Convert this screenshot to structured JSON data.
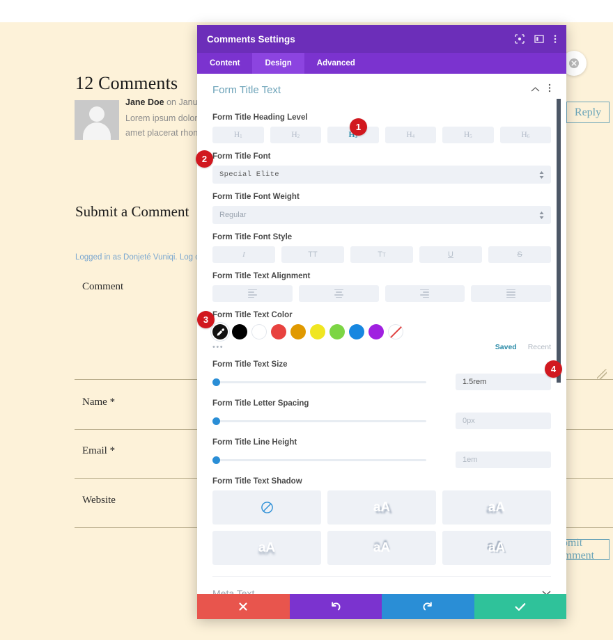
{
  "page": {
    "comments_heading": "12 Comments",
    "comment": {
      "author": "Jane Doe",
      "meta_suffix": " on January",
      "body_line1": "Lorem ipsum dolor sit",
      "body_line2": "amet placerat rhoncus"
    },
    "reply_button": "Reply",
    "submit_heading": "Submit a Comment",
    "logged_in_text": "Logged in as Donjeté Vuniqi. Log out?",
    "fields": [
      {
        "label": "Comment"
      },
      {
        "label": "Name *"
      },
      {
        "label": "Email *"
      },
      {
        "label": "Website"
      }
    ],
    "submit_button": "Submit Comment"
  },
  "modal": {
    "title": "Comments Settings",
    "header_icons": [
      "target-icon",
      "panel-layout-icon",
      "vertical-dots-icon"
    ],
    "tabs": [
      {
        "label": "Content",
        "active": false
      },
      {
        "label": "Design",
        "active": true
      },
      {
        "label": "Advanced",
        "active": false
      }
    ],
    "section": {
      "title": "Form Title Text",
      "collapse_icon": "chevron-up-icon",
      "menu_icon": "vertical-dots-icon"
    },
    "heading_level": {
      "label": "Form Title Heading Level",
      "options": [
        "H1",
        "H2",
        "H3",
        "H4",
        "H5",
        "H6"
      ],
      "selected": "H3"
    },
    "font": {
      "label": "Form Title Font",
      "value": "Special Elite"
    },
    "font_weight": {
      "label": "Form Title Font Weight",
      "value": "Regular"
    },
    "font_style": {
      "label": "Form Title Font Style",
      "options": [
        "italic",
        "uppercase",
        "small-caps",
        "underline",
        "strikethrough"
      ]
    },
    "text_alignment": {
      "label": "Form Title Text Alignment",
      "options": [
        "left",
        "center",
        "right",
        "justify"
      ]
    },
    "text_color": {
      "label": "Form Title Text Color",
      "picker": "eyedropper-icon",
      "swatches": [
        "#000000",
        "#ffffff",
        "#e8423f",
        "#e09900",
        "#f0e621",
        "#7cd544",
        "#1787e0",
        "#a020e0",
        "transparent"
      ],
      "more_icon": "ellipsis-icon",
      "saved_label": "Saved",
      "recent_label": "Recent"
    },
    "text_size": {
      "label": "Form Title Text Size",
      "value": "1.5rem",
      "filled": true
    },
    "letter_spacing": {
      "label": "Form Title Letter Spacing",
      "value": "0px",
      "filled": false
    },
    "line_height": {
      "label": "Form Title Line Height",
      "value": "1em",
      "filled": false
    },
    "text_shadow": {
      "label": "Form Title Text Shadow",
      "none_icon": "no-shadow-icon",
      "preset_glyph": "aA",
      "preset_count": 5
    },
    "meta_section": {
      "title": "Meta Text",
      "expand_icon": "chevron-down-icon"
    },
    "actions": {
      "cancel": "close-icon",
      "undo": "undo-icon",
      "redo": "redo-icon",
      "save": "check-icon"
    }
  },
  "callouts": [
    {
      "number": "1"
    },
    {
      "number": "2"
    },
    {
      "number": "3"
    },
    {
      "number": "4"
    }
  ],
  "colors": {
    "modal_header": "#6c2eb9",
    "tab_bar": "#7b33cf",
    "tab_active": "#8c44e0",
    "accent_teal": "#2b8ba8",
    "page_bg": "#fdf2d9",
    "badge_red": "#d1181f"
  }
}
